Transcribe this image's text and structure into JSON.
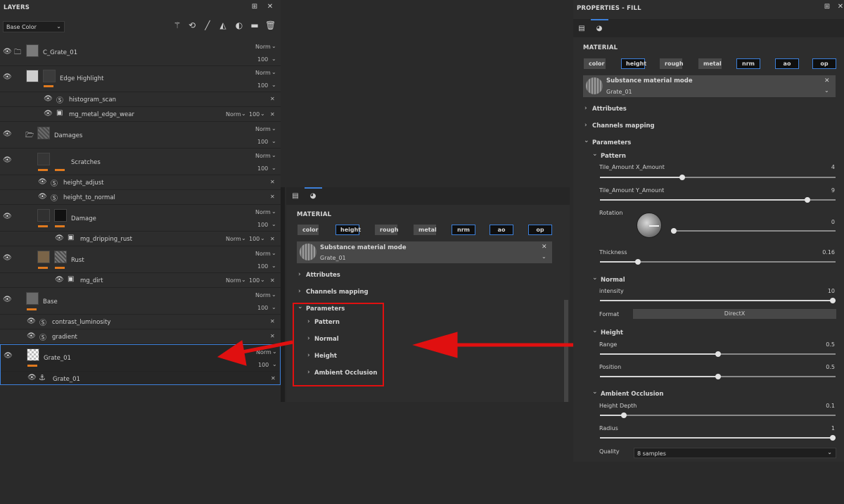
{
  "layers_panel": {
    "title": "LAYERS",
    "channel_select": "Base Color",
    "layers": [
      {
        "name": "C_Grate_01",
        "blend": "Norm",
        "opacity": "100"
      },
      {
        "name": "Edge Highlight",
        "blend": "Norm",
        "opacity": "100"
      },
      {
        "name": "histogram_scan"
      },
      {
        "name": "mg_metal_edge_wear",
        "blend": "Norm",
        "opacity": "100"
      },
      {
        "name": "Damages",
        "blend": "Norm",
        "opacity": "100"
      },
      {
        "name": "Scratches",
        "blend": "Norm",
        "opacity": "100"
      },
      {
        "name": "height_adjust"
      },
      {
        "name": "height_to_normal"
      },
      {
        "name": "Damage",
        "blend": "Norm",
        "opacity": "100"
      },
      {
        "name": "mg_dripping_rust",
        "blend": "Norm",
        "opacity": "100"
      },
      {
        "name": "Rust",
        "blend": "Norm",
        "opacity": "100"
      },
      {
        "name": "mg_dirt",
        "blend": "Norm",
        "opacity": "100"
      },
      {
        "name": "Base",
        "blend": "Norm",
        "opacity": "100"
      },
      {
        "name": "contrast_luminosity"
      },
      {
        "name": "gradient"
      },
      {
        "name": "Grate_01",
        "blend": "Norm",
        "opacity": "100"
      },
      {
        "name": "Grate_01"
      }
    ]
  },
  "middle_panel": {
    "material_label": "MATERIAL",
    "chips": [
      "color",
      "height",
      "rough",
      "metal",
      "nrm",
      "ao",
      "op"
    ],
    "mode_title": "Substance material mode",
    "mode_sub": "Grate_01",
    "sections": [
      "Attributes",
      "Channels mapping",
      "Parameters"
    ],
    "param_children": [
      "Pattern",
      "Normal",
      "Height",
      "Ambient Occlusion"
    ]
  },
  "properties_panel": {
    "title": "PROPERTIES - FILL",
    "material_label": "MATERIAL",
    "chips": [
      "color",
      "height",
      "rough",
      "metal",
      "nrm",
      "ao",
      "op"
    ],
    "mode_title": "Substance material mode",
    "mode_sub": "Grate_01",
    "attributes": "Attributes",
    "channels_mapping": "Channels mapping",
    "parameters": "Parameters",
    "pattern": {
      "header": "Pattern",
      "tile_x_label": "Tile_Amount X_Amount",
      "tile_x_value": "4",
      "tile_x_pos": 0.35,
      "tile_y_label": "Tile_Amount Y_Amount",
      "tile_y_value": "9",
      "tile_y_pos": 0.88,
      "rotation_label": "Rotation",
      "rotation_value": "0",
      "rotation_pos": 0.0,
      "thickness_label": "Thickness",
      "thickness_value": "0.16",
      "thickness_pos": 0.16
    },
    "normal": {
      "header": "Normal",
      "intensity_label": "intensity",
      "intensity_value": "10",
      "intensity_pos": 1.0,
      "format_label": "Format",
      "format_value": "DirectX"
    },
    "height": {
      "header": "Height",
      "range_label": "Range",
      "range_value": "0.5",
      "range_pos": 0.5,
      "position_label": "Position",
      "position_value": "0.5",
      "position_pos": 0.5
    },
    "ao": {
      "header": "Ambient Occlusion",
      "depth_label": "Height Depth",
      "depth_value": "0.1",
      "depth_pos": 0.1,
      "radius_label": "Radius",
      "radius_value": "1",
      "radius_pos": 1.0,
      "quality_label": "Quality",
      "quality_value": "8 samples"
    }
  },
  "colors": {
    "accent_blue": "#3c7fd9",
    "orange": "#e07a1f",
    "annotation_red": "#e01010"
  }
}
